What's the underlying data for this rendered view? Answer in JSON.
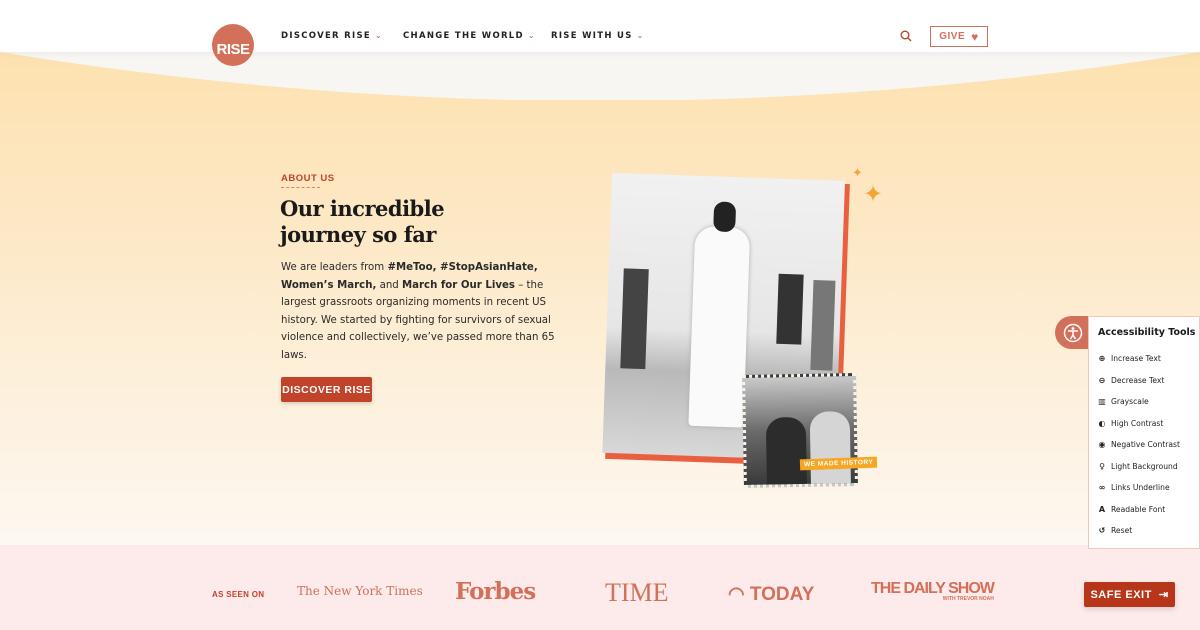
{
  "header": {
    "logo": "RISE",
    "nav": [
      {
        "label": "DISCOVER RISE"
      },
      {
        "label": "CHANGE THE WORLD"
      },
      {
        "label": "RISE WITH US"
      }
    ],
    "give_label": "GIVE"
  },
  "hero": {
    "eyebrow": "ABOUT US",
    "title_line1": "Our incredible",
    "title_line2": "journey so far",
    "para": {
      "t1": "We are leaders from ",
      "b1": "#MeToo, #StopAsianHate, Women’s March,",
      "t2": " and ",
      "b2": "March for Our Lives",
      "t3": " – the largest grassroots organizing moments in recent US history. We started by fighting for survivors of sexual violence and collectively, we’ve passed more than 65 laws."
    },
    "cta_label": "DISCOVER RISE",
    "photo_tag": "WE MADE HISTORY"
  },
  "press": {
    "label": "AS SEEN ON",
    "logos": [
      "The New York Times",
      "Forbes",
      "TIME",
      "TODAY",
      "THE DAILY SHOW",
      "WITH TREVOR NOAH"
    ]
  },
  "safe_exit_label": "SAFE EXIT",
  "accessibility": {
    "title": "Accessibility Tools",
    "items": [
      {
        "label": "Increase Text",
        "icon": "zoom-in-icon"
      },
      {
        "label": "Decrease Text",
        "icon": "zoom-out-icon"
      },
      {
        "label": "Grayscale",
        "icon": "barcode-icon"
      },
      {
        "label": "High Contrast",
        "icon": "contrast-icon"
      },
      {
        "label": "Negative Contrast",
        "icon": "eye-icon"
      },
      {
        "label": "Light Background",
        "icon": "lightbulb-icon"
      },
      {
        "label": "Links Underline",
        "icon": "link-icon"
      },
      {
        "label": "Readable Font",
        "icon": "font-icon"
      },
      {
        "label": "Reset",
        "icon": "reset-icon"
      }
    ]
  },
  "colors": {
    "accent": "#c0432a",
    "brand": "#d2705a",
    "gold": "#f5a623",
    "band": "#fcebea"
  }
}
